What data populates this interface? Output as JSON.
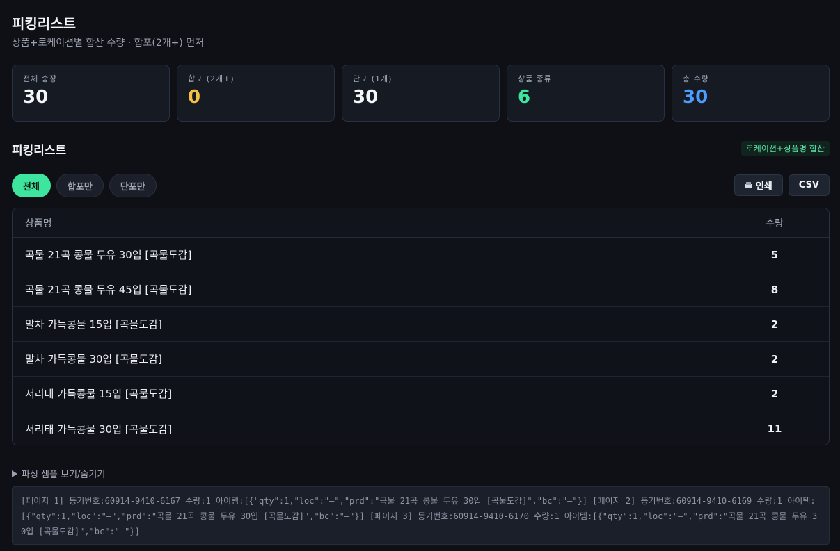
{
  "header": {
    "title": "피킹리스트",
    "subtitle": "상품+로케이션별 합산 수량 · 합포(2개+) 먼저"
  },
  "stats": [
    {
      "label": "전체 송장",
      "value": "30",
      "color": "#f4f6fa"
    },
    {
      "label": "합포 (2개+)",
      "value": "0",
      "color": "#f5c044"
    },
    {
      "label": "단포 (1개)",
      "value": "30",
      "color": "#f4f6fa"
    },
    {
      "label": "상품 종류",
      "value": "6",
      "color": "#3ee59f"
    },
    {
      "label": "총 수량",
      "value": "30",
      "color": "#4d9dff"
    }
  ],
  "section": {
    "title": "피킹리스트",
    "badge": "로케이션+상품명 합산"
  },
  "filters": {
    "all": "전체",
    "combined": "합포만",
    "single": "단포만"
  },
  "actions": {
    "print": "인쇄",
    "csv": "CSV"
  },
  "table": {
    "headers": {
      "name": "상품명",
      "qty": "수량"
    },
    "rows": [
      {
        "name": "곡물 21곡 콩물 두유 30입 [곡물도감]",
        "qty": "5"
      },
      {
        "name": "곡물 21곡 콩물 두유 45입 [곡물도감]",
        "qty": "8"
      },
      {
        "name": "말차 가득콩물 15입 [곡물도감]",
        "qty": "2"
      },
      {
        "name": "말차 가득콩물 30입 [곡물도감]",
        "qty": "2"
      },
      {
        "name": "서리태 가득콩물 15입 [곡물도감]",
        "qty": "2"
      },
      {
        "name": "서리태 가득콩물 30입 [곡물도감]",
        "qty": "11"
      }
    ]
  },
  "sample": {
    "toggle_label": "파싱 샘플 보기/숨기기",
    "text": "[페이지 1] 등기번호:60914-9410-6167 수량:1 아이템:[{\"qty\":1,\"loc\":\"—\",\"prd\":\"곡물 21곡 콩물 두유 30입 [곡물도감]\",\"bc\":\"—\"}] [페이지 2] 등기번호:60914-9410-6169 수량:1 아이템:[{\"qty\":1,\"loc\":\"—\",\"prd\":\"곡물 21곡 콩물 두유 30입 [곡물도감]\",\"bc\":\"—\"}] [페이지 3] 등기번호:60914-9410-6170 수량:1 아이템:[{\"qty\":1,\"loc\":\"—\",\"prd\":\"곡물 21곡 콩물 두유 30입 [곡물도감]\",\"bc\":\"—\"}]"
  }
}
